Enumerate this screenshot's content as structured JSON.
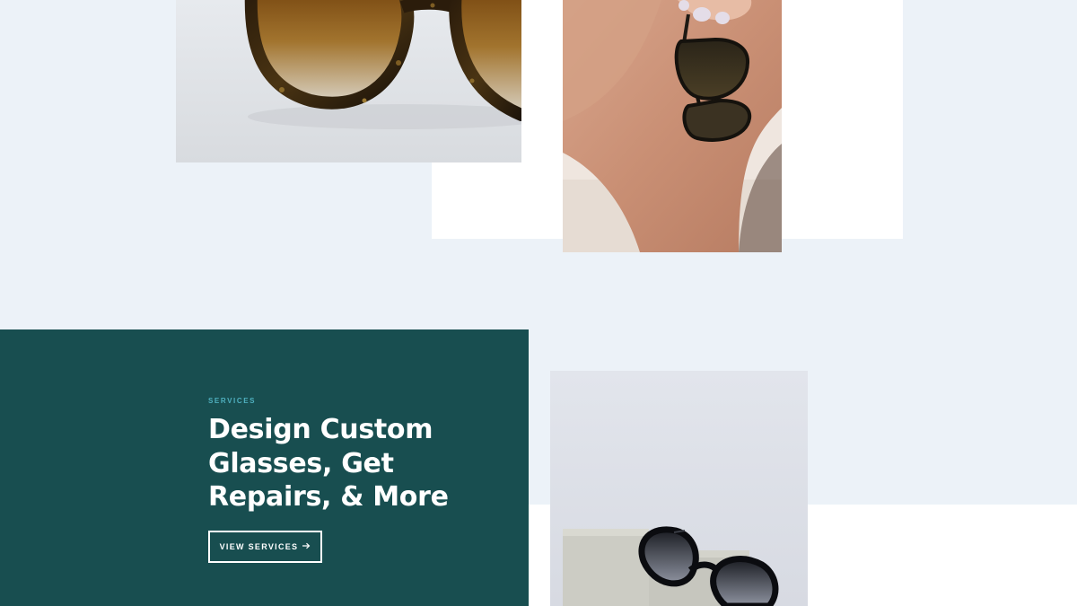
{
  "colors": {
    "page_background": "#ecf2f8",
    "panel_white": "#ffffff",
    "services_card": "#184e50",
    "eyebrow_accent": "#4fb0bf",
    "headline_text": "#ffffff"
  },
  "gallery": {
    "images": [
      {
        "subject": "close-up of tortoiseshell sunglasses with amber gradient lenses"
      },
      {
        "subject": "hand holding dark sunglasses by the temple above a knee"
      },
      {
        "subject": "black cat-eye sunglasses resting on pale stone blocks"
      }
    ]
  },
  "services": {
    "eyebrow": "SERVICES",
    "headline": "Design Custom Glasses, Get Repairs, & More",
    "cta_label": "VIEW SERVICES",
    "cta_icon": "arrow-right-icon"
  }
}
